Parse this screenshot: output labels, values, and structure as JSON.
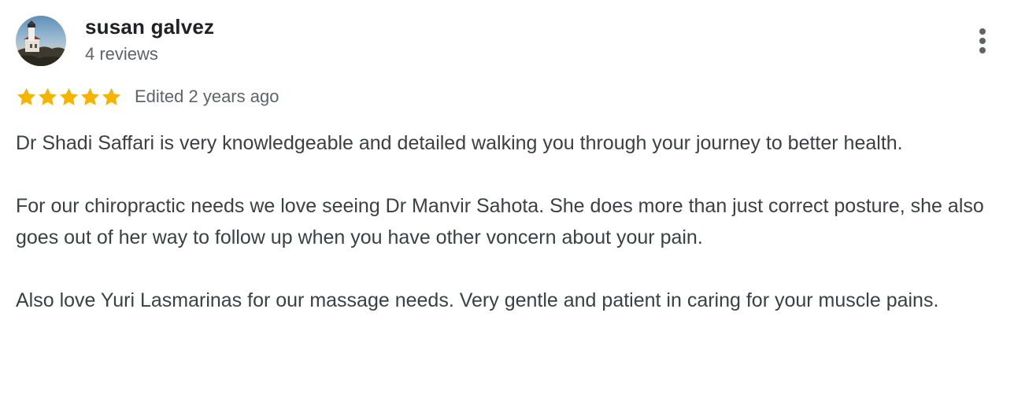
{
  "author": {
    "name": "susan galvez",
    "reviews_count": "4 reviews",
    "avatar": "lighthouse-photo-avatar"
  },
  "more_icon": "more-vert-icon",
  "rating": {
    "stars": 5,
    "max_stars": 5,
    "star_color": "#f4b400",
    "edited": "Edited 2 years ago"
  },
  "review": {
    "paragraphs": [
      "Dr Shadi Saffari is very knowledgeable and detailed walking you through your journey to better health.",
      "For our chiropractic needs we love seeing Dr Manvir Sahota. She does more than just correct posture, she also goes out of her way to follow up when you have other voncern about your pain.",
      "Also love Yuri Lasmarinas for our massage needs. Very gentle and patient in caring for your muscle pains."
    ]
  }
}
